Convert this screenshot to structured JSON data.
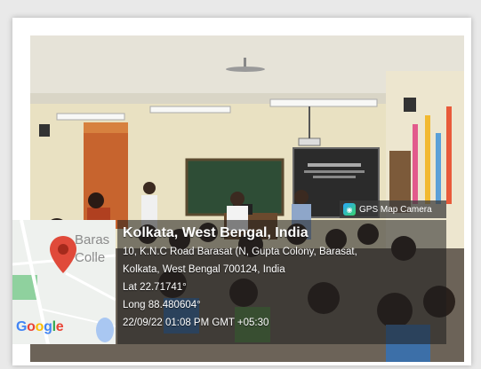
{
  "watermark": {
    "app_name": "GPS Map Camera",
    "app_icon": "gps-map-camera-icon"
  },
  "location": {
    "title": "Kolkata, West Bengal, India",
    "address_line1": "10, K.N.C Road Barasat (N, Gupta Colony, Barasat,",
    "address_line2": "Kolkata, West Bengal 700124, India",
    "latitude": "Lat 22.71741°",
    "longitude": "Long 88.480604°",
    "timestamp": "22/09/22 01:08 PM GMT +05:30"
  },
  "map": {
    "label_line1": "Baras",
    "label_line2": "Colle",
    "marker_icon": "map-pin-icon",
    "logo": "Google",
    "logo_colors": [
      "#4285F4",
      "#EA4335",
      "#FBBC05",
      "#4285F4",
      "#34A853",
      "#EA4335"
    ]
  }
}
